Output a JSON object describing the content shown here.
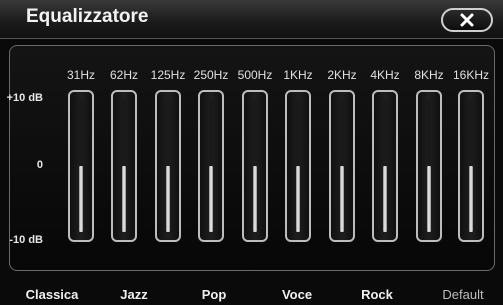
{
  "header": {
    "title": "Equalizzatore",
    "close_icon": "close-icon"
  },
  "scale": {
    "top": "+10 dB",
    "mid": "0",
    "bottom": "-10 dB"
  },
  "bands": [
    {
      "label": "31Hz",
      "level": 0.5
    },
    {
      "label": "62Hz",
      "level": 0.5
    },
    {
      "label": "125Hz",
      "level": 0.5
    },
    {
      "label": "250Hz",
      "level": 0.5
    },
    {
      "label": "500Hz",
      "level": 0.5
    },
    {
      "label": "1KHz",
      "level": 0.5
    },
    {
      "label": "2KHz",
      "level": 0.5
    },
    {
      "label": "4KHz",
      "level": 0.5
    },
    {
      "label": "8KHz",
      "level": 0.5
    },
    {
      "label": "16KHz",
      "level": 0.5
    }
  ],
  "presets": [
    "Classica",
    "Jazz",
    "Pop",
    "Voce",
    "Rock",
    "Default"
  ]
}
